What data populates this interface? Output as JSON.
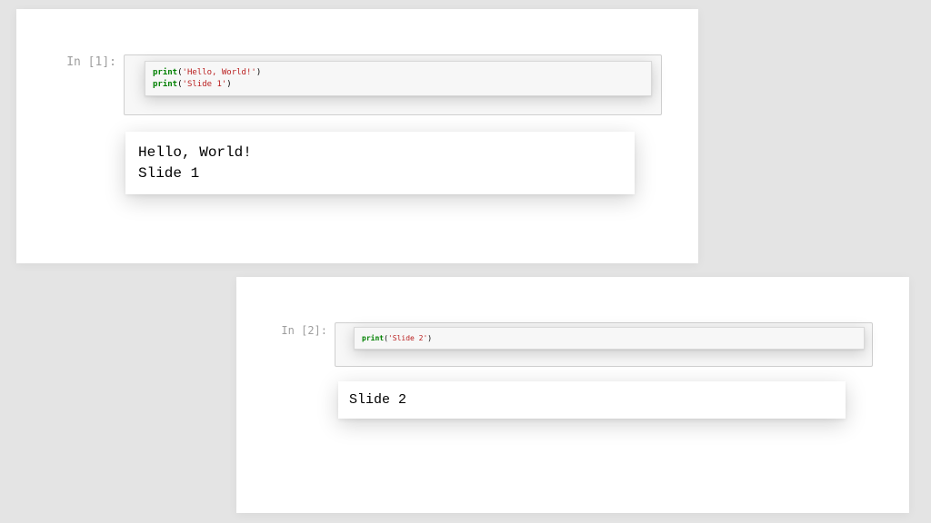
{
  "slides": {
    "s1": {
      "prompt": "In [1]:",
      "code": {
        "line1": {
          "fn": "print",
          "open": "(",
          "q1": "'",
          "arg": "Hello, World!",
          "q2": "'",
          "close": ")"
        },
        "line2": {
          "fn": "print",
          "open": "(",
          "q1": "'",
          "arg": "Slide 1",
          "q2": "'",
          "close": ")"
        }
      },
      "output": "Hello, World!\nSlide 1"
    },
    "s2": {
      "prompt": "In [2]:",
      "code": {
        "line1": {
          "fn": "print",
          "open": "(",
          "q1": "'",
          "arg": "Slide 2",
          "q2": "'",
          "close": ")"
        }
      },
      "output": "Slide 2"
    }
  }
}
